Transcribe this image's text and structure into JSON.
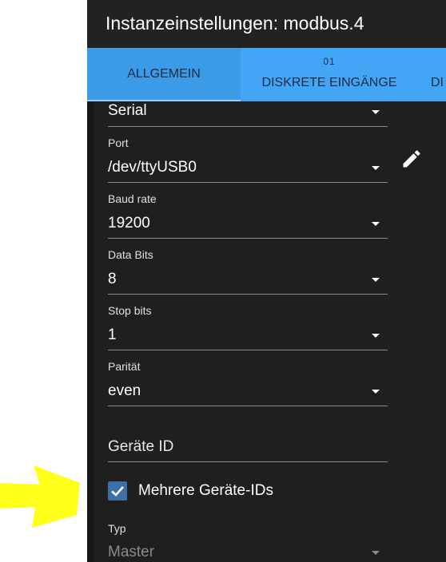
{
  "dialog": {
    "title": "Instanzeinstellungen: modbus.4"
  },
  "tabs": [
    {
      "label": "ALLGEMEIN",
      "active": true
    },
    {
      "icon_text": "01",
      "label": "DISKRETE EINGÄNGE"
    },
    {
      "label": "DI"
    }
  ],
  "form": {
    "connection_type": {
      "value": "Serial"
    },
    "port": {
      "label": "Port",
      "value": "/dev/ttyUSB0"
    },
    "baud_rate": {
      "label": "Baud rate",
      "value": "19200"
    },
    "data_bits": {
      "label": "Data Bits",
      "value": "8"
    },
    "stop_bits": {
      "label": "Stop bits",
      "value": "1"
    },
    "parity": {
      "label": "Parität",
      "value": "even"
    },
    "device_id": {
      "placeholder": "Geräte ID"
    },
    "multi_ids": {
      "label": "Mehrere Geräte-IDs",
      "checked": true
    },
    "type": {
      "label": "Typ",
      "value": "Master"
    }
  },
  "colors": {
    "tab_bar": "#42a5f5",
    "dialog_bg": "#1f1f1f",
    "checkbox": "#3d6fa8",
    "annotation_arrow": "#ffff1a"
  }
}
